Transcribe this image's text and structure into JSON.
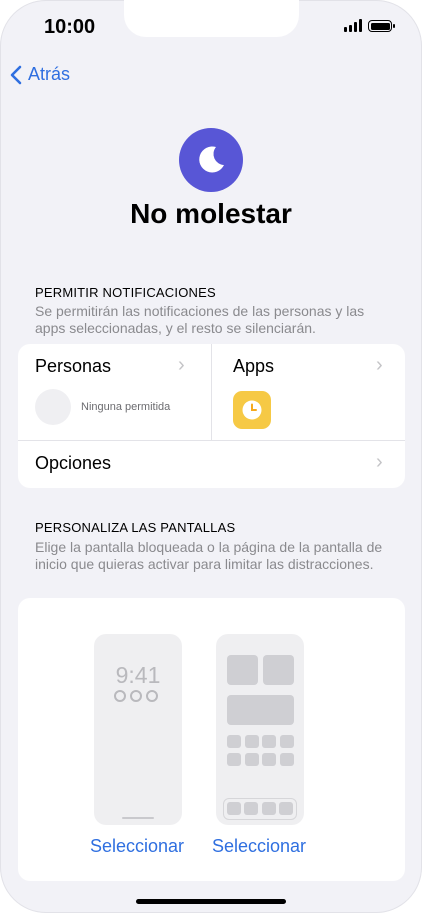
{
  "status_bar": {
    "time": "10:00"
  },
  "nav": {
    "back_label": "Atrás"
  },
  "header": {
    "title": "No molestar"
  },
  "notifications": {
    "section_title": "PERMITIR NOTIFICACIONES",
    "description": "Se permitirán las notificaciones de las personas y las apps seleccionadas, y el resto se silenciarán.",
    "people_label": "Personas",
    "people_status": "Ninguna permitida",
    "apps_label": "Apps",
    "options_label": "Opciones"
  },
  "screens": {
    "section_title": "PERSONALIZA LAS PANTALLAS",
    "description": "Elige la pantalla bloqueada o la página de la pantalla de inicio que quieras activar para limitar las distracciones.",
    "lock_time": "9:41",
    "lock_select_label": "Seleccionar",
    "home_select_label": "Seleccionar"
  },
  "colors": {
    "accent": "#2f6fe0",
    "focus_purple": "#5856d6",
    "clock_yellow": "#f6c945"
  },
  "icons": [
    "chevron-left-icon",
    "moon-icon",
    "chevron-right-icon",
    "clock-icon",
    "signal-icon",
    "battery-icon"
  ]
}
